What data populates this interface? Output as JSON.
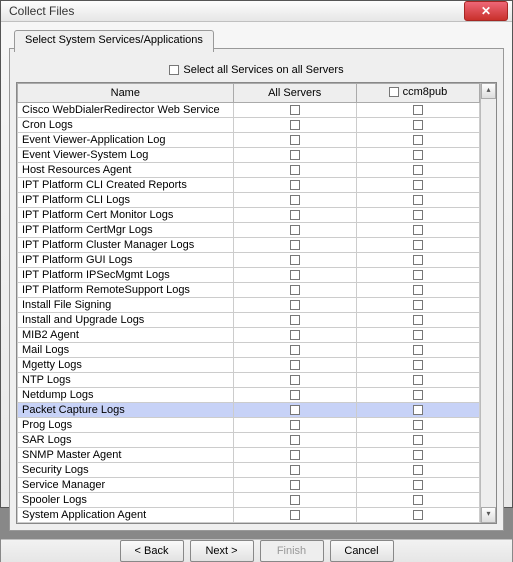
{
  "window": {
    "title": "Collect Files"
  },
  "tab": {
    "label": "Select System Services/Applications"
  },
  "selectAll": {
    "label": "Select all Services on all Servers"
  },
  "columns": {
    "name": "Name",
    "allServers": "All Servers",
    "server1": "ccm8pub"
  },
  "rows": [
    {
      "name": "Cisco WebDialerRedirector Web Service",
      "selected": false
    },
    {
      "name": "Cron Logs",
      "selected": false
    },
    {
      "name": "Event Viewer-Application Log",
      "selected": false
    },
    {
      "name": "Event Viewer-System Log",
      "selected": false
    },
    {
      "name": "Host Resources Agent",
      "selected": false
    },
    {
      "name": "IPT Platform CLI Created Reports",
      "selected": false
    },
    {
      "name": "IPT Platform CLI Logs",
      "selected": false
    },
    {
      "name": "IPT Platform Cert Monitor Logs",
      "selected": false
    },
    {
      "name": "IPT Platform CertMgr Logs",
      "selected": false
    },
    {
      "name": "IPT Platform Cluster Manager Logs",
      "selected": false
    },
    {
      "name": "IPT Platform GUI Logs",
      "selected": false
    },
    {
      "name": "IPT Platform IPSecMgmt Logs",
      "selected": false
    },
    {
      "name": "IPT Platform RemoteSupport Logs",
      "selected": false
    },
    {
      "name": "Install File Signing",
      "selected": false
    },
    {
      "name": "Install and Upgrade Logs",
      "selected": false
    },
    {
      "name": "MIB2 Agent",
      "selected": false
    },
    {
      "name": "Mail Logs",
      "selected": false
    },
    {
      "name": "Mgetty Logs",
      "selected": false
    },
    {
      "name": "NTP Logs",
      "selected": false
    },
    {
      "name": "Netdump Logs",
      "selected": false
    },
    {
      "name": "Packet Capture Logs",
      "selected": true
    },
    {
      "name": "Prog Logs",
      "selected": false
    },
    {
      "name": "SAR Logs",
      "selected": false
    },
    {
      "name": "SNMP Master Agent",
      "selected": false
    },
    {
      "name": "Security Logs",
      "selected": false
    },
    {
      "name": "Service Manager",
      "selected": false
    },
    {
      "name": "Spooler Logs",
      "selected": false
    },
    {
      "name": "System Application Agent",
      "selected": false
    }
  ],
  "buttons": {
    "back": "< Back",
    "next": "Next >",
    "finish": "Finish",
    "cancel": "Cancel"
  }
}
